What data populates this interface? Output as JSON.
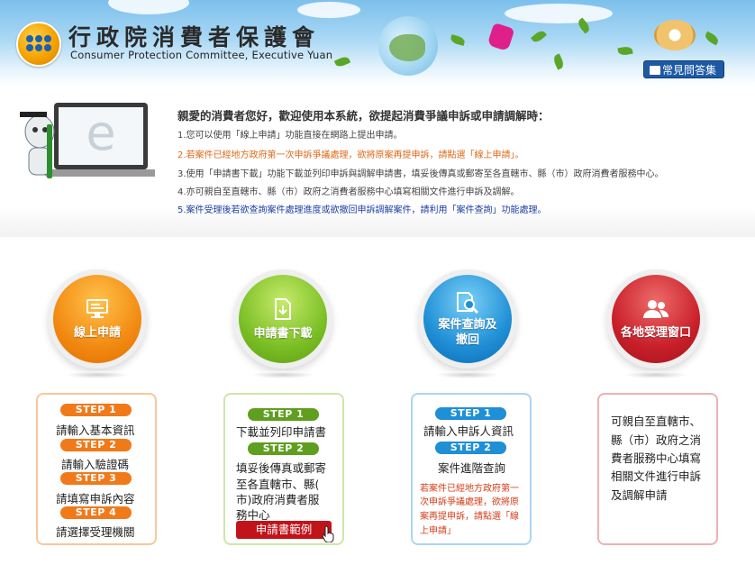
{
  "header": {
    "title_zh": "行政院消費者保護會",
    "title_en": "Consumer Protection Committee, Executive Yuan",
    "faq_label": "常見問答集"
  },
  "intro": {
    "heading": "親愛的消費者您好，歡迎使用本系統，欲提起消費爭議申訴或申請調解時：",
    "lines": [
      "1.您可以使用「線上申請」功能直接在網路上提出申請。",
      "2.若案件已經地方政府第一次申訴爭議處理，欲將原案再提申訴，請點選「線上申請」。",
      "3.使用「申請書下載」功能下載並列印申訴與調解申請書，填妥後傳真或郵寄至各直轄市、縣（市）政府消費者服務中心。",
      "4.亦可親自至直轄市、縣（市）政府之消費者服務中心填寫相關文件進行申訴及調解。",
      "5.案件受理後若欲查詢案件處理進度或欲撤回申訴調解案件，請利用「案件查詢」功能處理。"
    ]
  },
  "services": [
    {
      "label": "線上申請",
      "icon": "monitor-icon",
      "color": "#f28a12"
    },
    {
      "label": "申請書下載",
      "icon": "download-document-icon",
      "color": "#7bbf25"
    },
    {
      "label1": "案件查詢及",
      "label2": "撤回",
      "icon": "document-search-icon",
      "color": "#1f8fd6"
    },
    {
      "label": "各地受理窗口",
      "icon": "people-icon",
      "color": "#c9202a"
    }
  ],
  "panels": {
    "online": {
      "step1": "STEP 1",
      "step1_text": "請輸入基本資訊",
      "step2": "STEP 2",
      "step2_text": "請輸入驗證碼",
      "step3": "STEP 3",
      "step3_text": "請填寫申訴內容",
      "step4": "STEP 4",
      "step4_text": "請選擇受理機關"
    },
    "download": {
      "step1": "STEP 1",
      "step1_text": "下載並列印申請書",
      "step2": "STEP 2",
      "step2_lines": [
        "填妥後傳真或郵寄",
        "至各直轄市、縣(",
        "市)政府消費者服",
        "務中心"
      ],
      "sample_button": "申請書範例"
    },
    "query": {
      "step1": "STEP 1",
      "step1_text": "請輸入申訴人資訊",
      "step2": "STEP 2",
      "step2_text": "案件進階查詢",
      "note_lines": [
        "若案件已經地方政府第一",
        "次申訴爭議處理，欲將原",
        "案再提申訴，請點選「線",
        "上申請」"
      ]
    },
    "window": {
      "lines": [
        "可親自至直轄市、",
        "縣（市）政府之消",
        "費者服務中心填寫",
        "相關文件進行申訴",
        "及調解申請"
      ]
    }
  },
  "colors": {
    "orange": "#f28a12",
    "green": "#7bbf25",
    "blue": "#1f8fd6",
    "red": "#c9202a",
    "faq_blue": "#1d5aa6"
  }
}
